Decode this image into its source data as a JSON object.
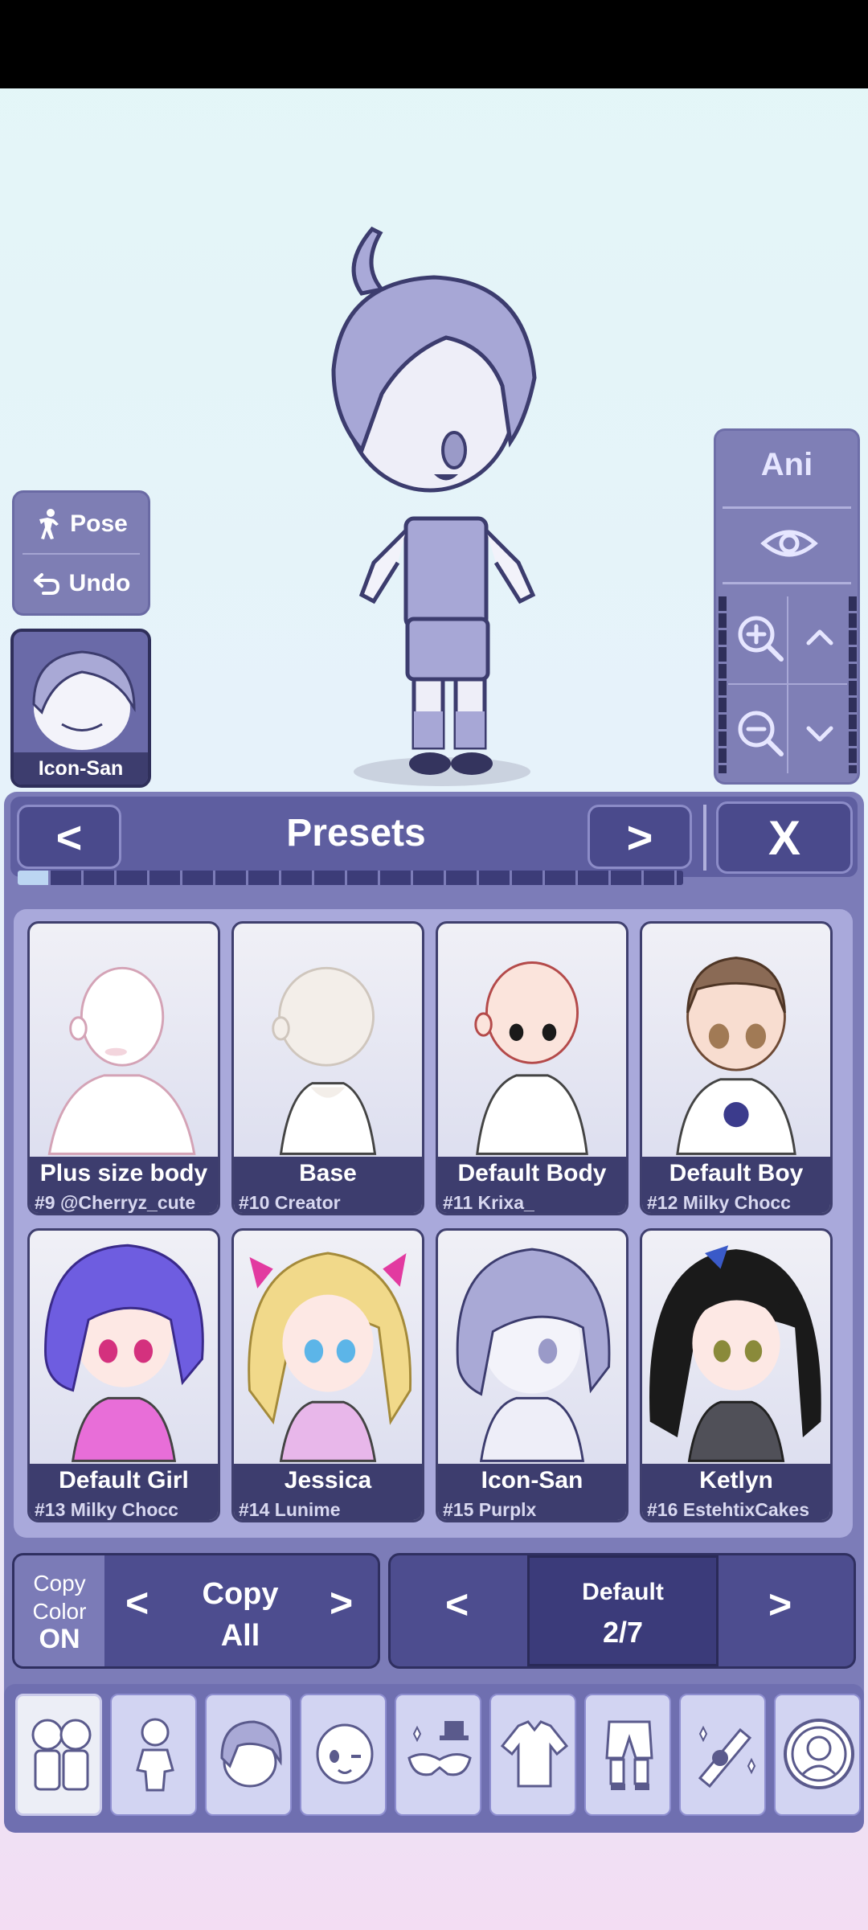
{
  "left_controls": {
    "pose_label": "Pose",
    "undo_label": "Undo"
  },
  "selected_character": {
    "name": "Icon-San"
  },
  "camera_panel": {
    "ani_label": "Ani"
  },
  "presets_panel": {
    "title": "Presets",
    "prev_label": "<",
    "next_label": ">",
    "close_label": "X",
    "page_progress": 0.05
  },
  "presets": [
    {
      "name": "Plus size body",
      "credit": "#9 @Cherryz_cute"
    },
    {
      "name": "Base",
      "credit": "#10 Creator"
    },
    {
      "name": "Default Body",
      "credit": "#11 Krixa_"
    },
    {
      "name": "Default Boy",
      "credit": "#12 Milky Chocc"
    },
    {
      "name": "Default Girl",
      "credit": "#13 Milky Chocc"
    },
    {
      "name": "Jessica",
      "credit": "#14 Lunime"
    },
    {
      "name": "Icon-San",
      "credit": "#15 Purplx"
    },
    {
      "name": "Ketlyn",
      "credit": "#16 EstehtixCakes"
    }
  ],
  "copy_bar": {
    "copy_label": "Copy",
    "color_label": "Color",
    "state": "ON",
    "copy_all_line1": "Copy",
    "copy_all_line2": "All",
    "left_arrow": "<",
    "right_arrow": ">"
  },
  "page_bar": {
    "name": "Default",
    "count": "2/7",
    "left_arrow": "<",
    "right_arrow": ">"
  },
  "categories": [
    {
      "icon": "presets-icon",
      "active": true
    },
    {
      "icon": "body-icon",
      "active": false
    },
    {
      "icon": "hair-icon",
      "active": false
    },
    {
      "icon": "face-icon",
      "active": false
    },
    {
      "icon": "accessory-icon",
      "active": false
    },
    {
      "icon": "shirt-icon",
      "active": false
    },
    {
      "icon": "pants-icon",
      "active": false
    },
    {
      "icon": "props-icon",
      "active": false
    },
    {
      "icon": "profile-icon",
      "active": false
    }
  ]
}
